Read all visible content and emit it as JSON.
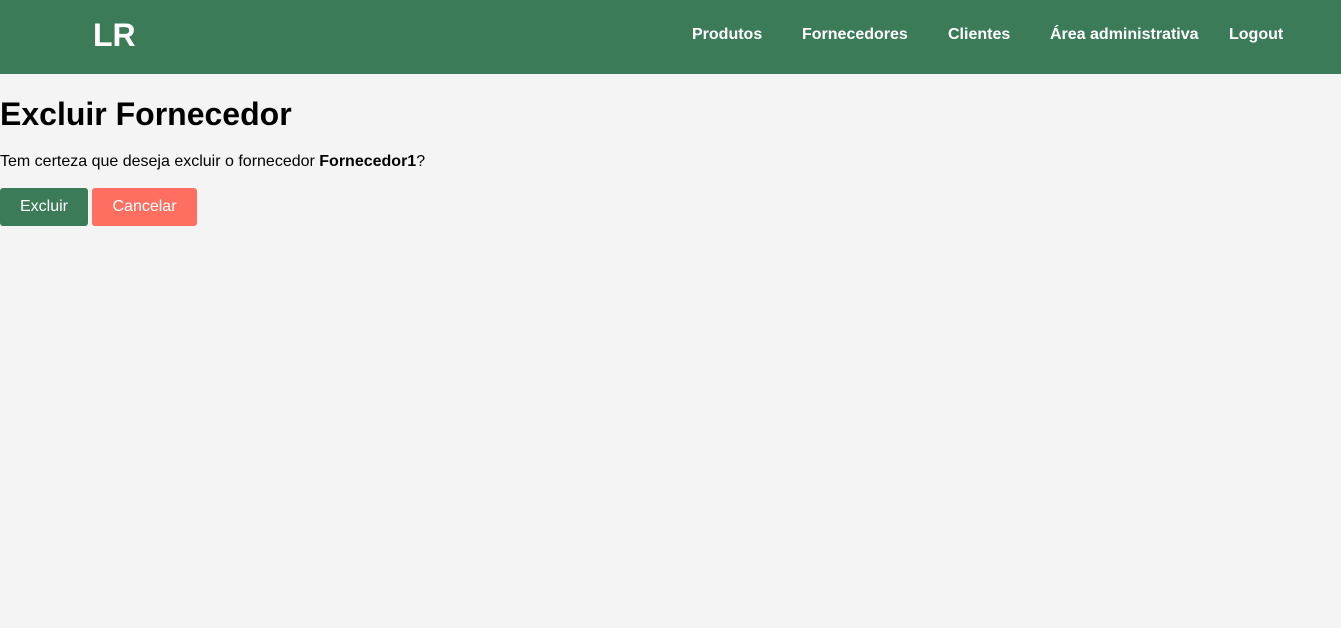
{
  "header": {
    "logo": "LR",
    "nav": [
      {
        "label": "Produtos"
      },
      {
        "label": "Fornecedores"
      },
      {
        "label": "Clientes"
      },
      {
        "label": "Área administrativa"
      },
      {
        "label": "Logout"
      }
    ]
  },
  "main": {
    "title": "Excluir Fornecedor",
    "confirm_prefix": "Tem certeza que deseja excluir o fornecedor ",
    "supplier_name": "Fornecedor1",
    "confirm_suffix": "?",
    "delete_label": "Excluir",
    "cancel_label": "Cancelar"
  },
  "colors": {
    "primary": "#3b7b58",
    "danger": "#ff6f61",
    "background": "#f4f4f4"
  }
}
